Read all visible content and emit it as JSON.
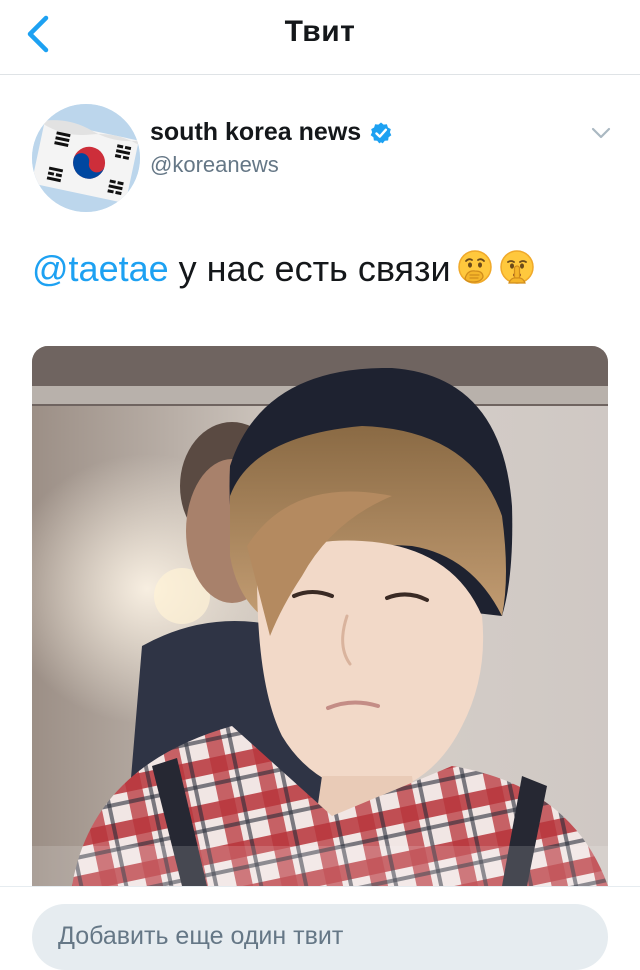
{
  "header": {
    "title": "Твит"
  },
  "tweet": {
    "display_name": "south korea news",
    "handle": "@koreanews",
    "mention": "@taetae",
    "text": " у нас есть связи",
    "emojis": [
      "thinking-face-hand-over-mouth",
      "shushing-face"
    ]
  },
  "composer": {
    "placeholder": "Добавить еще один твит"
  },
  "colors": {
    "accent": "#1da1f2",
    "text": "#14171a",
    "muted": "#657786",
    "composer_bg": "#e6ecf0"
  }
}
